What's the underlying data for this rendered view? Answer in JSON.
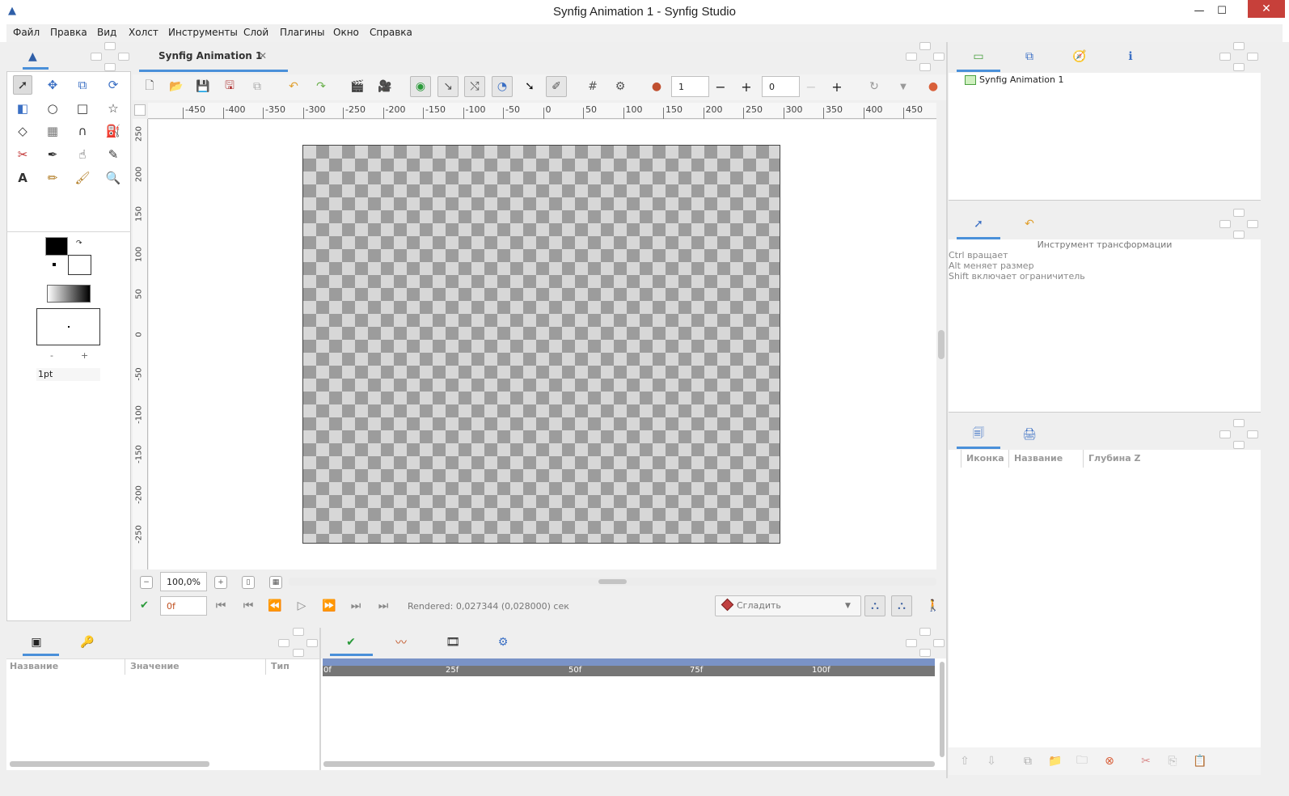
{
  "window": {
    "title": "Synfig Animation 1 - Synfig Studio",
    "minimize": "—",
    "maximize": "☐",
    "close": "✕"
  },
  "menu": [
    "Файл",
    "Правка",
    "Вид",
    "Холст",
    "Инструменты",
    "Слой",
    "Плагины",
    "Окно",
    "Справка"
  ],
  "document_tab": {
    "label": "Synfig Animation 1",
    "close": "✕"
  },
  "toolbar": {
    "lower_bound": "1",
    "upper_bound": "0",
    "minus": "−",
    "plus": "+"
  },
  "ruler_h": [
    "-450",
    "-400",
    "-350",
    "-300",
    "-250",
    "-200",
    "-150",
    "-100",
    "-50",
    "0",
    "50",
    "100",
    "150",
    "200",
    "250",
    "300",
    "350",
    "400",
    "450"
  ],
  "ruler_v": [
    "250",
    "200",
    "150",
    "100",
    "50",
    "0",
    "-50",
    "-100",
    "-150",
    "-200",
    "-250"
  ],
  "zoom": "100,0%",
  "frame_field": "0f",
  "render_status": "Rendered: 0,027344 (0,028000) сек",
  "interpolation": "Сгладить",
  "brush": {
    "size": "1pt",
    "minus": "-",
    "plus": "+"
  },
  "canvas_browser": {
    "item": "Synfig Animation 1"
  },
  "tool_options": {
    "title": "Инструмент трансформации",
    "lines": [
      "Ctrl вращает",
      "Alt меняет размер",
      "Shift включает ограничитель"
    ]
  },
  "layers_panel": {
    "columns": [
      "Иконка",
      "Название",
      "Глубина Z"
    ]
  },
  "params_panel": {
    "columns": [
      "Название",
      "Значение",
      "Тип"
    ]
  },
  "timetrack": {
    "marks": [
      "0f",
      "25f",
      "50f",
      "75f",
      "100f"
    ]
  },
  "colors": {
    "accent": "#4a90d9",
    "timebar": "#7a93c7",
    "close_red": "#c7403a"
  }
}
